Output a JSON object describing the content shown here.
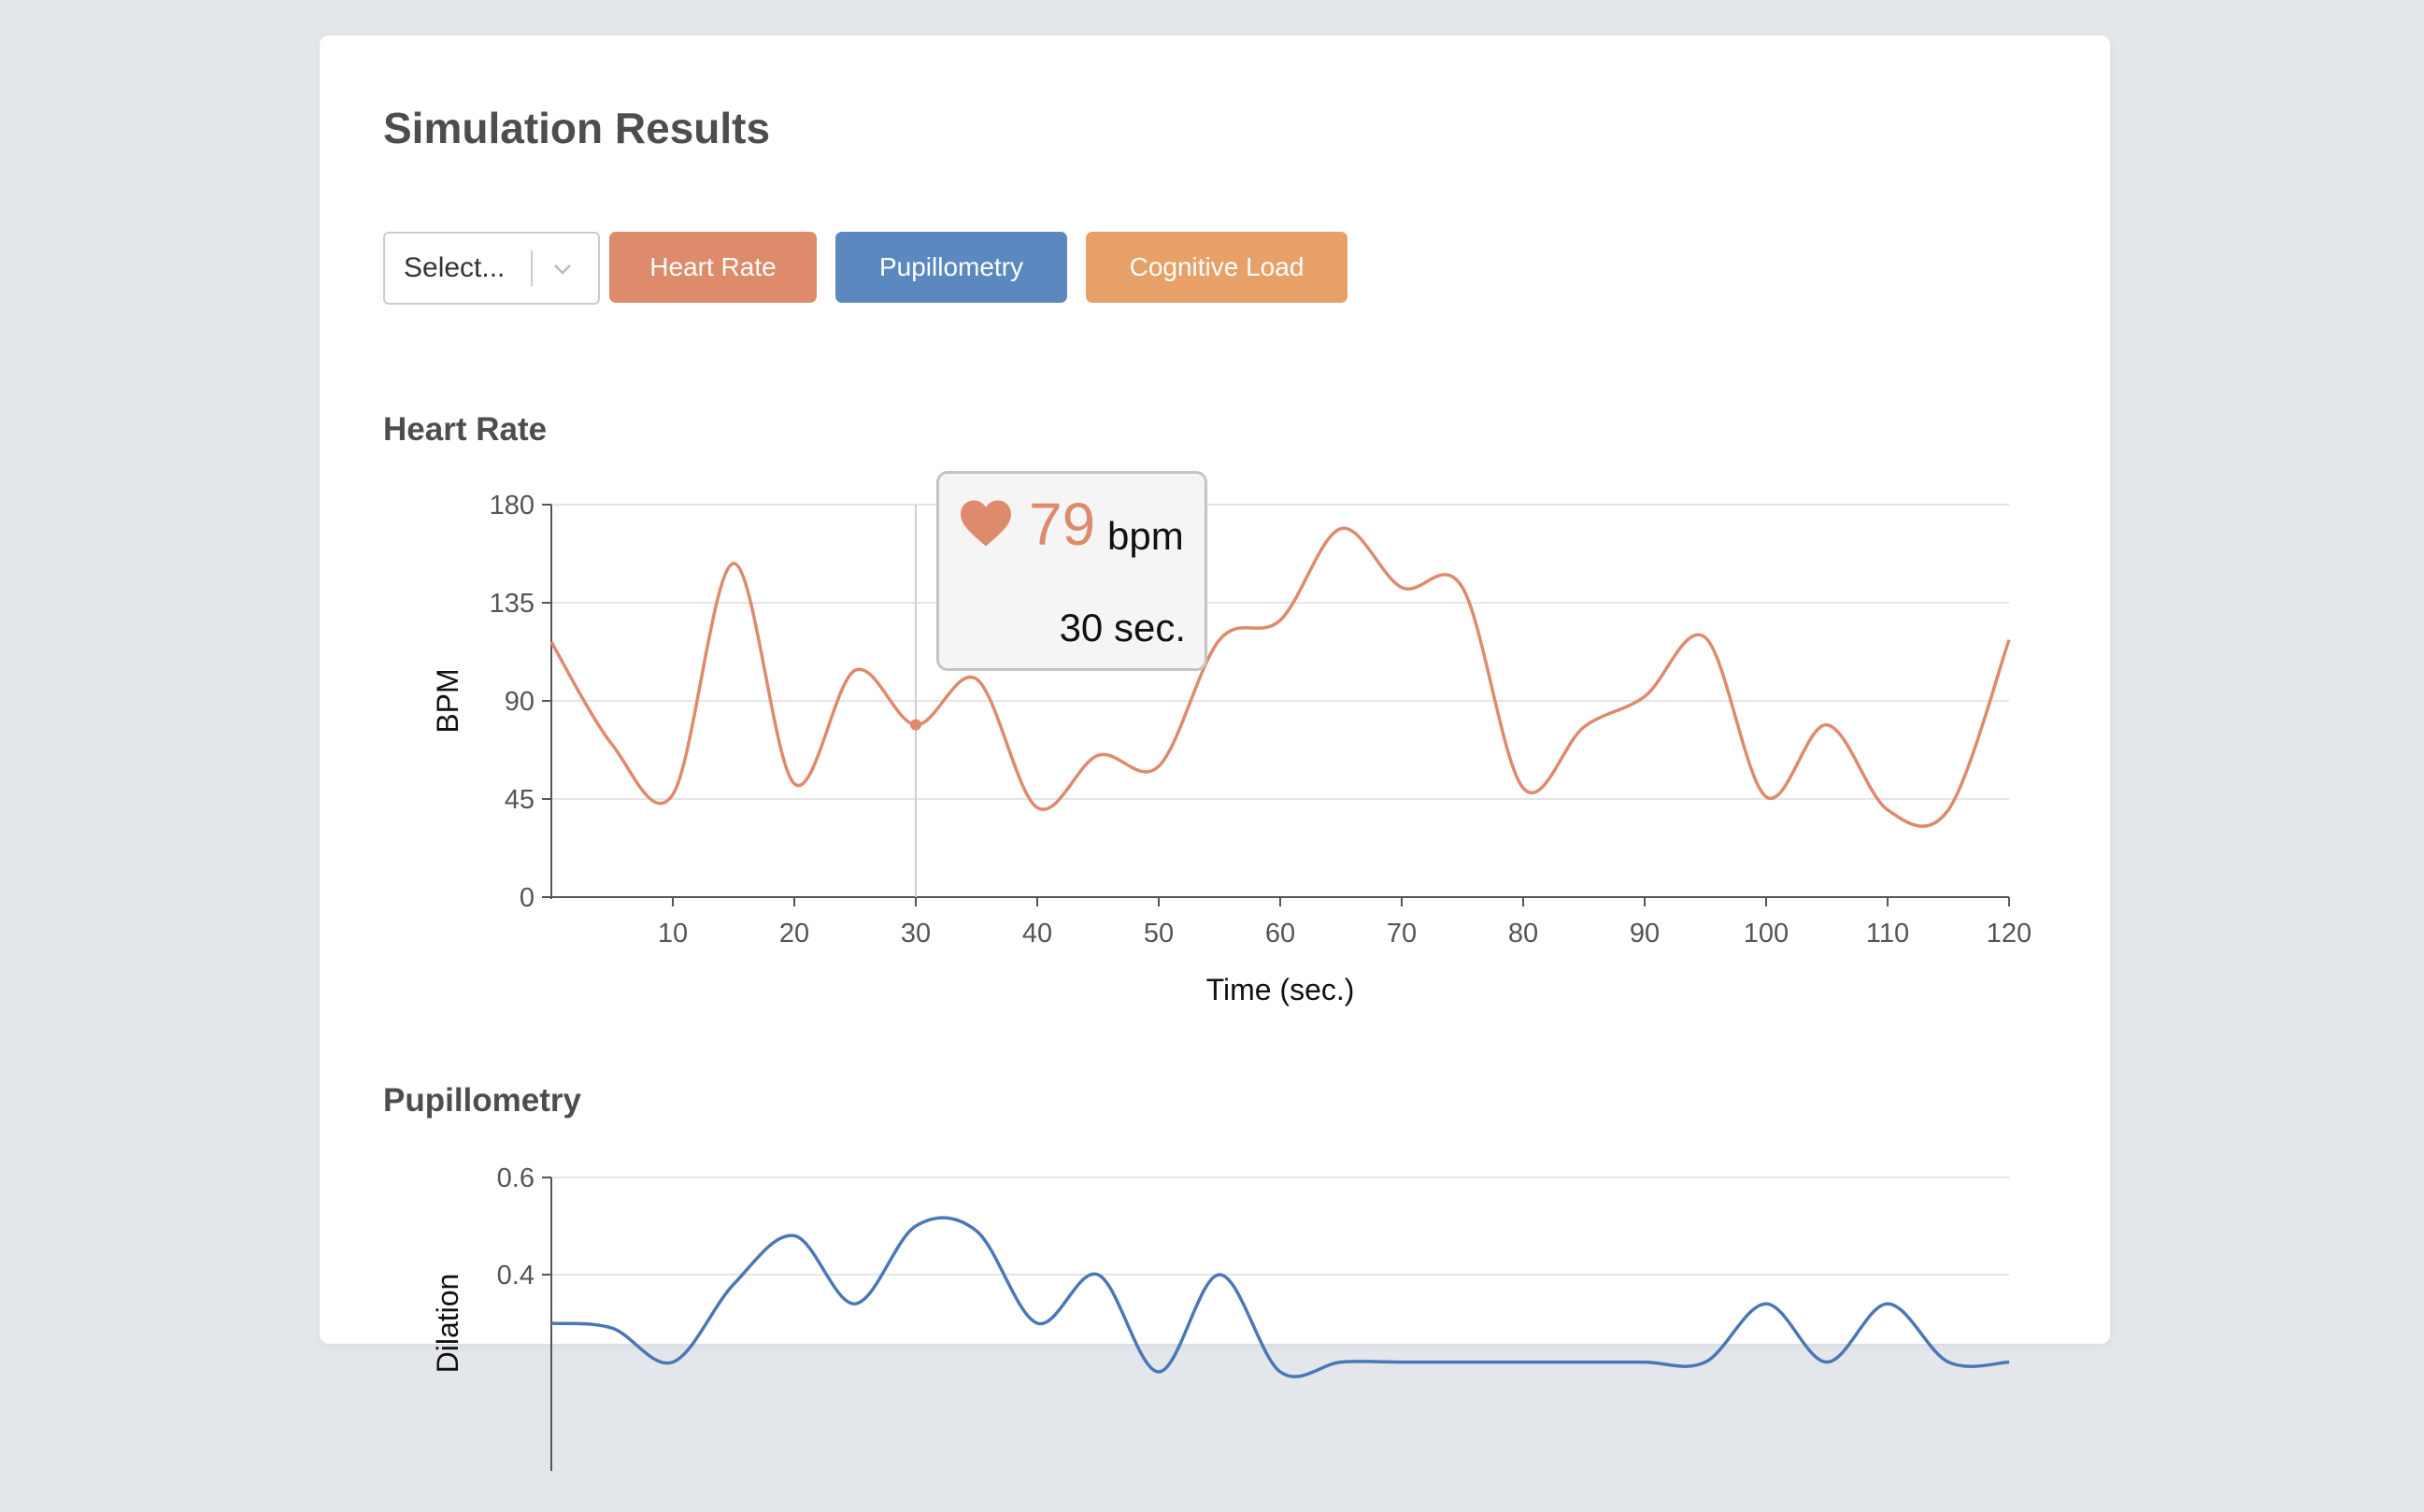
{
  "page": {
    "title": "Simulation Results"
  },
  "controls": {
    "select": {
      "value": "Select..."
    },
    "buttons": [
      {
        "label": "Heart Rate",
        "color": "#dd8b6b"
      },
      {
        "label": "Pupillometry",
        "color": "#5c88c0"
      },
      {
        "label": "Cognitive Load",
        "color": "#e6a068"
      }
    ]
  },
  "colors": {
    "heart_rate": "#dd8b6b",
    "pupillometry": "#4a78b5",
    "grid": "#e5e5e5",
    "axis": "#555555"
  },
  "tooltip": {
    "icon": "heart-icon",
    "value": "79",
    "unit": "bpm",
    "time": "30 sec."
  },
  "chart_data": [
    {
      "type": "line",
      "title": "Heart Rate",
      "xlabel": "Time (sec.)",
      "ylabel": "BPM",
      "xlim": [
        0,
        120
      ],
      "ylim": [
        0,
        180
      ],
      "xticks": [
        10,
        20,
        30,
        40,
        50,
        60,
        70,
        80,
        90,
        100,
        110,
        120
      ],
      "yticks": [
        0,
        45,
        90,
        135,
        180
      ],
      "grid": true,
      "hover_x": 30,
      "hover_y": 79,
      "series": [
        {
          "color": "#dd8b6b",
          "x": [
            0,
            5,
            10,
            15,
            20,
            25,
            30,
            35,
            40,
            45,
            50,
            55,
            60,
            65,
            70,
            75,
            80,
            85,
            90,
            95,
            100,
            105,
            110,
            115,
            120
          ],
          "values": [
            117,
            70,
            47,
            153,
            52,
            104,
            79,
            100,
            41,
            65,
            60,
            118,
            127,
            169,
            142,
            142,
            50,
            78,
            92,
            119,
            46,
            79,
            40,
            40,
            118
          ]
        }
      ]
    },
    {
      "type": "line",
      "title": "Pupillometry",
      "xlabel": "",
      "ylabel": "Dilation",
      "xlim": [
        0,
        120
      ],
      "ylim": [
        0,
        0.6
      ],
      "yticks": [
        0.4,
        0.6
      ],
      "grid": true,
      "series": [
        {
          "color": "#4a78b5",
          "x": [
            0,
            5,
            10,
            15,
            20,
            25,
            30,
            35,
            40,
            45,
            50,
            55,
            60,
            65,
            70,
            75,
            80,
            85,
            90,
            95,
            100,
            105,
            110,
            115,
            120
          ],
          "values": [
            0.3,
            0.29,
            0.22,
            0.38,
            0.48,
            0.34,
            0.5,
            0.49,
            0.3,
            0.4,
            0.2,
            0.4,
            0.2,
            0.22,
            0.22,
            0.22,
            0.22,
            0.22,
            0.22,
            0.22,
            0.34,
            0.22,
            0.34,
            0.22,
            0.22
          ]
        }
      ]
    }
  ]
}
